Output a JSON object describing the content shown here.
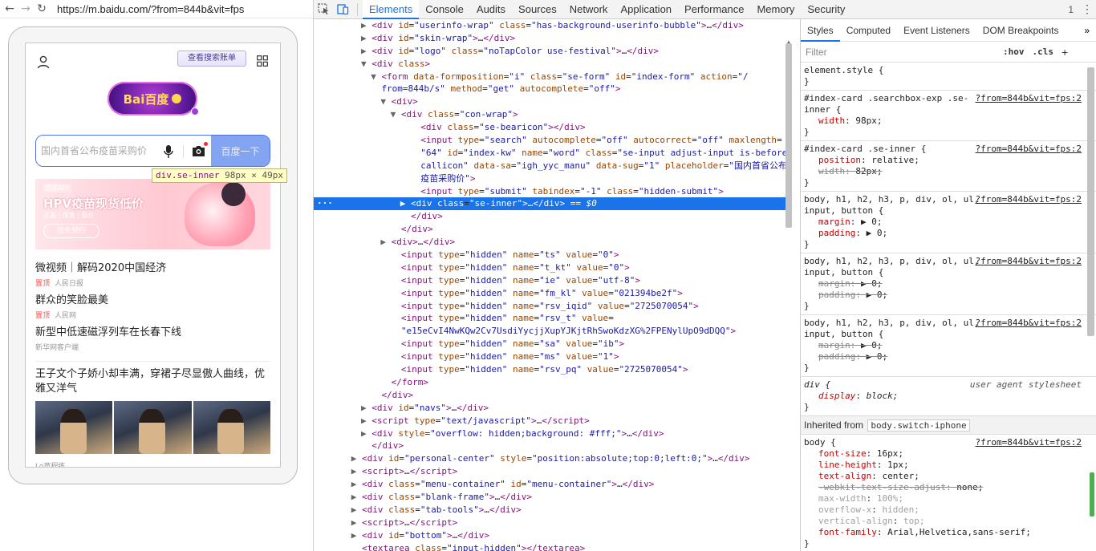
{
  "browser": {
    "url": "https://m.baidu.com/?from=844b&vit=fps",
    "back": "←",
    "forward": "→",
    "reload": "↻"
  },
  "page": {
    "promo_pill": "查看搜索账单",
    "logo_text": "Bai百度",
    "search_placeholder": "国内首省公布疫苗采购价",
    "search_button": "百度一下",
    "tooltip": {
      "tag": "div",
      "class": ".se-inner",
      "size": "98px × 49px"
    },
    "banner": {
      "app": "百度APP",
      "headline": "HPV疫苗现货低价",
      "subline": "正品 | 保真 | 低价",
      "cta": "抢先预约"
    },
    "news": [
      {
        "title": "微视频｜解码2020中国经济",
        "pin": "置顶",
        "source": "人民日报"
      },
      {
        "title": "群众的笑脸最美",
        "pin": "置顶",
        "source": "人民网"
      },
      {
        "title": "新型中低速磁浮列车在长春下线",
        "pin": "",
        "source": "新华网客户端"
      },
      {
        "title": "王子文个子娇小却丰满，穿裙子尽显傲人曲线，优雅又洋气",
        "pin": "",
        "source": ""
      }
    ],
    "footer_hint": "Lo童程练"
  },
  "devtools": {
    "tabs": [
      "Elements",
      "Console",
      "Audits",
      "Sources",
      "Network",
      "Application",
      "Performance",
      "Memory",
      "Security"
    ],
    "active_tab": "Elements",
    "count": "1",
    "more": "⋮",
    "styles_tabs": [
      "Styles",
      "Computed",
      "Event Listeners",
      "DOM Breakpoints"
    ],
    "styles_more": "»",
    "filter_placeholder": "Filter",
    "hov": ":hov",
    "cls": ".cls",
    "plus": "+",
    "inherited_label": "Inherited from",
    "inherited_badge": "body.switch-iphone"
  },
  "dom_lines": [
    {
      "indent": 5,
      "tri": "▶",
      "html": "<span class='tag'>&lt;div</span> <span class='an'>id</span>=<span class='av'>\"userinfo-wrap\"</span> <span class='an'>class</span>=<span class='av'>\"has-background-userinfo-bubble\"</span><span class='tag'>&gt;</span>…<span class='tag'>&lt;/div&gt;</span>"
    },
    {
      "indent": 5,
      "tri": "▶",
      "html": "<span class='tag'>&lt;div</span> <span class='an'>id</span>=<span class='av'>\"skin-wrap\"</span><span class='tag'>&gt;</span>…<span class='tag'>&lt;/div&gt;</span>"
    },
    {
      "indent": 5,
      "tri": "▶",
      "html": "<span class='tag'>&lt;div</span> <span class='an'>id</span>=<span class='av'>\"logo\"</span> <span class='an'>class</span>=<span class='av'>\"noTapColor use-festival\"</span><span class='tag'>&gt;</span>…<span class='tag'>&lt;/div&gt;</span>"
    },
    {
      "indent": 5,
      "tri": "▼",
      "html": "<span class='tag'>&lt;div</span> <span class='an'>class</span><span class='tag'>&gt;</span>"
    },
    {
      "indent": 6,
      "tri": "▼",
      "html": "<span class='tag'>&lt;form</span> <span class='an'>data-formposition</span>=<span class='av'>\"i\"</span> <span class='an'>class</span>=<span class='av'>\"se-form\"</span> <span class='an'>id</span>=<span class='av'>\"index-form\"</span> <span class='an'>action</span>=<span class='av'>\"/</span>"
    },
    {
      "indent": 6,
      "tri": "",
      "html": "<span class='av'>from=844b/s\"</span> <span class='an'>method</span>=<span class='av'>\"get\"</span> <span class='an'>autocomplete</span>=<span class='av'>\"off\"</span><span class='tag'>&gt;</span>"
    },
    {
      "indent": 7,
      "tri": "▼",
      "html": "<span class='tag'>&lt;div&gt;</span>"
    },
    {
      "indent": 8,
      "tri": "▼",
      "html": "<span class='tag'>&lt;div</span> <span class='an'>class</span>=<span class='av'>\"con-wrap\"</span><span class='tag'>&gt;</span>"
    },
    {
      "indent": 10,
      "tri": "",
      "html": "<span class='tag'>&lt;div</span> <span class='an'>class</span>=<span class='av'>\"se-bearicon\"</span><span class='tag'>&gt;&lt;/div&gt;</span>"
    },
    {
      "indent": 10,
      "tri": "",
      "html": "<span class='tag'>&lt;input</span> <span class='an'>type</span>=<span class='av'>\"search\"</span> <span class='an'>autocomplete</span>=<span class='av'>\"off\"</span> <span class='an'>autocorrect</span>=<span class='av'>\"off\"</span> <span class='an'>maxlength</span>="
    },
    {
      "indent": 10,
      "tri": "",
      "html": "<span class='av'>\"64\"</span> <span class='an'>id</span>=<span class='av'>\"index-kw\"</span> <span class='an'>name</span>=<span class='av'>\"word\"</span> <span class='an'>class</span>=<span class='av'>\"se-input adjust-input is-before-</span>"
    },
    {
      "indent": 10,
      "tri": "",
      "html": "<span class='av'>callicon\"</span> <span class='an'>data-sa</span>=<span class='av'>\"igh_yyc_manu\"</span> <span class='an'>data-sug</span>=<span class='av'>\"1\"</span> <span class='an'>placeholder</span>=<span class='av'>\"国内首省公布</span>"
    },
    {
      "indent": 10,
      "tri": "",
      "html": "<span class='av'>疫苗采购价\"</span><span class='tag'>&gt;</span>"
    },
    {
      "indent": 10,
      "tri": "",
      "html": "<span class='tag'>&lt;input</span> <span class='an'>type</span>=<span class='av'>\"submit\"</span> <span class='an'>tabindex</span>=<span class='av'>\"-1\"</span> <span class='an'>class</span>=<span class='av'>\"hidden-submit\"</span><span class='tag'>&gt;</span>"
    },
    {
      "indent": 9,
      "tri": "▶",
      "sel": true,
      "html": "<span class='tag'>&lt;div</span> <span class='an'>class</span>=<span class='av'>\"se-inner\"</span><span class='tag'>&gt;</span><span class='tx'>…</span><span class='tag'>&lt;/div&gt;</span> <span class='eq'>== $0</span>"
    },
    {
      "indent": 9,
      "tri": "",
      "html": "<span class='tag'>&lt;/div&gt;</span>"
    },
    {
      "indent": 8,
      "tri": "",
      "html": "<span class='tag'>&lt;/div&gt;</span>"
    },
    {
      "indent": 7,
      "tri": "▶",
      "html": "<span class='tag'>&lt;div&gt;</span>…<span class='tag'>&lt;/div&gt;</span>"
    },
    {
      "indent": 8,
      "tri": "",
      "html": "<span class='tag'>&lt;input</span> <span class='an'>type</span>=<span class='av'>\"hidden\"</span> <span class='an'>name</span>=<span class='av'>\"ts\"</span> <span class='an'>value</span>=<span class='av'>\"0\"</span><span class='tag'>&gt;</span>"
    },
    {
      "indent": 8,
      "tri": "",
      "html": "<span class='tag'>&lt;input</span> <span class='an'>type</span>=<span class='av'>\"hidden\"</span> <span class='an'>name</span>=<span class='av'>\"t_kt\"</span> <span class='an'>value</span>=<span class='av'>\"0\"</span><span class='tag'>&gt;</span>"
    },
    {
      "indent": 8,
      "tri": "",
      "html": "<span class='tag'>&lt;input</span> <span class='an'>type</span>=<span class='av'>\"hidden\"</span> <span class='an'>name</span>=<span class='av'>\"ie\"</span> <span class='an'>value</span>=<span class='av'>\"utf-8\"</span><span class='tag'>&gt;</span>"
    },
    {
      "indent": 8,
      "tri": "",
      "html": "<span class='tag'>&lt;input</span> <span class='an'>type</span>=<span class='av'>\"hidden\"</span> <span class='an'>name</span>=<span class='av'>\"fm_kl\"</span> <span class='an'>value</span>=<span class='av'>\"021394be2f\"</span><span class='tag'>&gt;</span>"
    },
    {
      "indent": 8,
      "tri": "",
      "html": "<span class='tag'>&lt;input</span> <span class='an'>type</span>=<span class='av'>\"hidden\"</span> <span class='an'>name</span>=<span class='av'>\"rsv_iqid\"</span> <span class='an'>value</span>=<span class='av'>\"2725070054\"</span><span class='tag'>&gt;</span>"
    },
    {
      "indent": 8,
      "tri": "",
      "html": "<span class='tag'>&lt;input</span> <span class='an'>type</span>=<span class='av'>\"hidden\"</span> <span class='an'>name</span>=<span class='av'>\"rsv_t\"</span> <span class='an'>value</span>="
    },
    {
      "indent": 8,
      "tri": "",
      "html": "<span class='av'>\"e15eCvI4NwKQw2Cv7UsdiYycjjXupYJKjtRhSwoKdzXG%2FPENylUpO9dDQQ\"</span><span class='tag'>&gt;</span>"
    },
    {
      "indent": 8,
      "tri": "",
      "html": "<span class='tag'>&lt;input</span> <span class='an'>type</span>=<span class='av'>\"hidden\"</span> <span class='an'>name</span>=<span class='av'>\"sa\"</span> <span class='an'>value</span>=<span class='av'>\"ib\"</span><span class='tag'>&gt;</span>"
    },
    {
      "indent": 8,
      "tri": "",
      "html": "<span class='tag'>&lt;input</span> <span class='an'>type</span>=<span class='av'>\"hidden\"</span> <span class='an'>name</span>=<span class='av'>\"ms\"</span> <span class='an'>value</span>=<span class='av'>\"1\"</span><span class='tag'>&gt;</span>"
    },
    {
      "indent": 8,
      "tri": "",
      "html": "<span class='tag'>&lt;input</span> <span class='an'>type</span>=<span class='av'>\"hidden\"</span> <span class='an'>name</span>=<span class='av'>\"rsv_pq\"</span> <span class='an'>value</span>=<span class='av'>\"2725070054\"</span><span class='tag'>&gt;</span>"
    },
    {
      "indent": 7,
      "tri": "",
      "html": "<span class='tag'>&lt;/form&gt;</span>"
    },
    {
      "indent": 6,
      "tri": "",
      "html": "<span class='tag'>&lt;/div&gt;</span>"
    },
    {
      "indent": 5,
      "tri": "▶",
      "html": "<span class='tag'>&lt;div</span> <span class='an'>id</span>=<span class='av'>\"navs\"</span><span class='tag'>&gt;</span>…<span class='tag'>&lt;/div&gt;</span>"
    },
    {
      "indent": 5,
      "tri": "▶",
      "html": "<span class='tag'>&lt;script</span> <span class='an'>type</span>=<span class='av'>\"text/javascript\"</span><span class='tag'>&gt;</span>…<span class='tag'>&lt;/script&gt;</span>"
    },
    {
      "indent": 5,
      "tri": "▶",
      "html": "<span class='tag'>&lt;div</span> <span class='an'>style</span>=<span class='av'>\"overflow: hidden;background: #fff;\"</span><span class='tag'>&gt;</span>…<span class='tag'>&lt;/div&gt;</span>"
    },
    {
      "indent": 5,
      "tri": "",
      "html": "<span class='tag'>&lt;/div&gt;</span>"
    },
    {
      "indent": 4,
      "tri": "▶",
      "html": "<span class='tag'>&lt;div</span> <span class='an'>id</span>=<span class='av'>\"personal-center\"</span> <span class='an'>style</span>=<span class='av'>\"position:absolute;top:0;left:0;\"</span><span class='tag'>&gt;</span>…<span class='tag'>&lt;/div&gt;</span>"
    },
    {
      "indent": 4,
      "tri": "▶",
      "html": "<span class='tag'>&lt;script&gt;</span>…<span class='tag'>&lt;/script&gt;</span>"
    },
    {
      "indent": 4,
      "tri": "▶",
      "html": "<span class='tag'>&lt;div</span> <span class='an'>class</span>=<span class='av'>\"menu-container\"</span> <span class='an'>id</span>=<span class='av'>\"menu-container\"</span><span class='tag'>&gt;</span>…<span class='tag'>&lt;/div&gt;</span>"
    },
    {
      "indent": 4,
      "tri": "▶",
      "html": "<span class='tag'>&lt;div</span> <span class='an'>class</span>=<span class='av'>\"blank-frame\"</span><span class='tag'>&gt;</span>…<span class='tag'>&lt;/div&gt;</span>"
    },
    {
      "indent": 4,
      "tri": "▶",
      "html": "<span class='tag'>&lt;div</span> <span class='an'>class</span>=<span class='av'>\"tab-tools\"</span><span class='tag'>&gt;</span>…<span class='tag'>&lt;/div&gt;</span>"
    },
    {
      "indent": 4,
      "tri": "▶",
      "html": "<span class='tag'>&lt;script&gt;</span>…<span class='tag'>&lt;/script&gt;</span>"
    },
    {
      "indent": 4,
      "tri": "▶",
      "html": "<span class='tag'>&lt;div</span> <span class='an'>id</span>=<span class='av'>\"bottom\"</span><span class='tag'>&gt;</span>…<span class='tag'>&lt;/div&gt;</span>"
    },
    {
      "indent": 4,
      "tri": "",
      "html": "<span class='tag'>&lt;textarea</span> <span class='an'>class</span>=<span class='av'>\"input-hidden\"</span><span class='tag'>&gt;&lt;/textarea&gt;</span>"
    }
  ],
  "style_rules": [
    {
      "selector": "element.style {",
      "source": "",
      "props": []
    },
    {
      "selector": "#index-card .searchbox-exp .se-inner {",
      "source": "?from=844b&vit=fps:2",
      "props": [
        {
          "n": "width",
          "v": "98px;",
          "state": ""
        }
      ]
    },
    {
      "selector": "#index-card .se-inner {",
      "source": "?from=844b&vit=fps:2",
      "props": [
        {
          "n": "position",
          "v": "relative;",
          "state": ""
        },
        {
          "n": "width",
          "v": "82px;",
          "state": "struck"
        }
      ]
    },
    {
      "selector": "body, h1, h2, h3, p, div, ol, ul, input, button {",
      "source": "?from=844b&vit=fps:2",
      "props": [
        {
          "n": "margin",
          "v": "▶ 0;",
          "state": ""
        },
        {
          "n": "padding",
          "v": "▶ 0;",
          "state": ""
        }
      ]
    },
    {
      "selector": "body, h1, h2, h3, p, div, ol, ul, input, button {",
      "source": "?from=844b&vit=fps:2",
      "props": [
        {
          "n": "margin",
          "v": "▶ 0;",
          "state": "struck"
        },
        {
          "n": "padding",
          "v": "▶ 0;",
          "state": "struck"
        }
      ]
    },
    {
      "selector": "body, h1, h2, h3, p, div, ol, ul, input, button {",
      "source": "?from=844b&vit=fps:2",
      "props": [
        {
          "n": "margin",
          "v": "▶ 0;",
          "state": "struck"
        },
        {
          "n": "padding",
          "v": "▶ 0;",
          "state": "struck"
        }
      ]
    },
    {
      "selector": "div {",
      "source": "user agent stylesheet",
      "ua": true,
      "props": [
        {
          "n": "display",
          "v": "block;",
          "state": "italic"
        }
      ]
    }
  ],
  "body_rule": {
    "selector": "body {",
    "source": "?from=844b&vit=fps:2",
    "props": [
      {
        "n": "font-size",
        "v": "16px;",
        "state": ""
      },
      {
        "n": "line-height",
        "v": "1px;",
        "state": ""
      },
      {
        "n": "text-align",
        "v": "center;",
        "state": ""
      },
      {
        "n": "-webkit-text-size-adjust",
        "v": "none;",
        "state": "struck"
      },
      {
        "n": "max-width",
        "v": "100%;",
        "state": "dimmed"
      },
      {
        "n": "overflow-x",
        "v": "hidden;",
        "state": "dimmed"
      },
      {
        "n": "vertical-align",
        "v": "top;",
        "state": "dimmed"
      },
      {
        "n": "font-family",
        "v": "Arial,Helvetica,sans-serif;",
        "state": ""
      }
    ]
  },
  "colors": {
    "accent": "#1a73e8",
    "search_border": "#4e6ef2",
    "search_button": "#82a4f1",
    "pin": "#f54d4d"
  }
}
